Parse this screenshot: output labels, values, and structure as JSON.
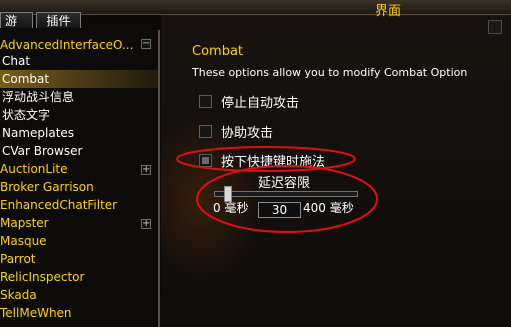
{
  "window": {
    "title": "界面"
  },
  "tabs": [
    {
      "label": "游戏"
    },
    {
      "label": "插件"
    }
  ],
  "sidebar": {
    "items": [
      {
        "label": "AdvancedInterfaceO...",
        "color": "#ffd100",
        "expander": "−"
      },
      {
        "label": "Chat",
        "color": "#ffffff"
      },
      {
        "label": "Combat",
        "color": "#ffffff"
      },
      {
        "label": "浮动战斗信息",
        "color": "#ffffff"
      },
      {
        "label": "状态文字",
        "color": "#ffffff"
      },
      {
        "label": "Nameplates",
        "color": "#ffffff"
      },
      {
        "label": "CVar Browser",
        "color": "#ffffff"
      },
      {
        "label": "AuctionLite",
        "color": "#ffd100",
        "expander": "+"
      },
      {
        "label": "Broker Garrison",
        "color": "#ffd100"
      },
      {
        "label": "EnhancedChatFilter",
        "color": "#ffd100"
      },
      {
        "label": "Mapster",
        "color": "#ffd100",
        "expander": "+"
      },
      {
        "label": "Masque",
        "color": "#ffd100"
      },
      {
        "label": "Parrot",
        "color": "#ffd100"
      },
      {
        "label": "RelicInspector",
        "color": "#ffd100"
      },
      {
        "label": "Skada",
        "color": "#ffd100"
      },
      {
        "label": "TellMeWhen",
        "color": "#ffd100"
      }
    ]
  },
  "main": {
    "title": "Combat",
    "description": "These options allow you to modify Combat Option",
    "options": [
      {
        "label": "停止自动攻击",
        "checked": false
      },
      {
        "label": "协助攻击",
        "checked": false
      },
      {
        "label": "按下快捷键时施法",
        "checked": true
      }
    ],
    "slider": {
      "label": "延迟容限",
      "min_label": "0 毫秒",
      "max_label": "400 毫秒",
      "value": "30",
      "fraction": 0.075
    }
  },
  "colors": {
    "accent": "#ffd100",
    "annotation": "#e01010",
    "selected": "#d2a028"
  }
}
